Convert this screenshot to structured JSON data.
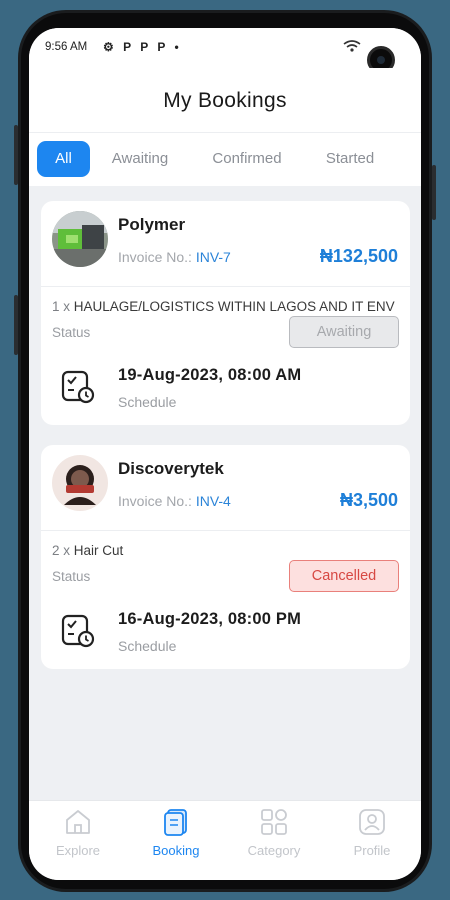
{
  "statusbar": {
    "time": "9:56 AM",
    "icons": "⚙ P P P •",
    "right": "WiFi"
  },
  "header": {
    "title": "My Bookings"
  },
  "tabs": [
    {
      "label": "All",
      "active": true
    },
    {
      "label": "Awaiting",
      "active": false
    },
    {
      "label": "Confirmed",
      "active": false
    },
    {
      "label": "Started",
      "active": false
    }
  ],
  "bookings": [
    {
      "vendor": "Polymer",
      "invoice_label": "Invoice No.: ",
      "invoice_no": "INV-7",
      "price": "₦132,500",
      "quantity": "1 x",
      "item": "HAULAGE/LOGISTICS WITHIN LAGOS AND IT ENV",
      "status_label": "Status",
      "status": "Awaiting",
      "schedule_date": "19-Aug-2023, 08:00 AM",
      "schedule_label": "Schedule"
    },
    {
      "vendor": "Discoverytek",
      "invoice_label": "Invoice No.: ",
      "invoice_no": "INV-4",
      "price": "₦3,500",
      "quantity": "2 x",
      "item": "Hair Cut",
      "status_label": "Status",
      "status": "Cancelled",
      "schedule_date": "16-Aug-2023, 08:00 PM",
      "schedule_label": "Schedule"
    }
  ],
  "bottom_nav": [
    {
      "label": "Explore",
      "icon": "home-icon",
      "active": false
    },
    {
      "label": "Booking",
      "icon": "booking-icon",
      "active": true
    },
    {
      "label": "Category",
      "icon": "category-icon",
      "active": false
    },
    {
      "label": "Profile",
      "icon": "profile-icon",
      "active": false
    }
  ],
  "colors": {
    "accent": "#1d86f0",
    "price": "#1e7fd8",
    "cancelled": "#d74843",
    "background": "#3a6882"
  }
}
